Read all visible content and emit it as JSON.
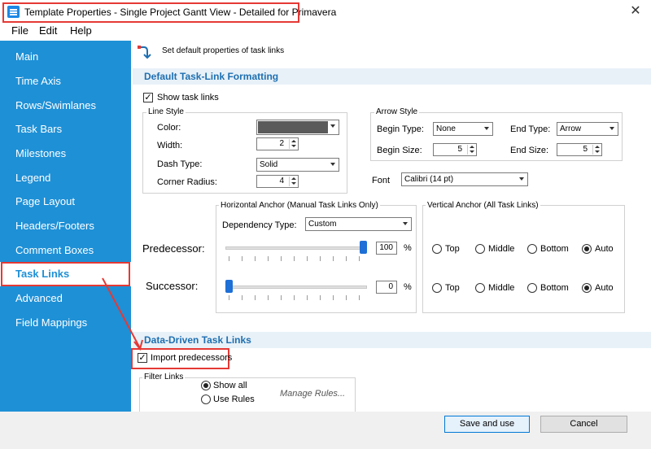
{
  "window": {
    "title": "Template Properties - Single Project Gantt View - Detailed for Primavera",
    "close_glyph": "✕"
  },
  "menu": {
    "file": "File",
    "edit": "Edit",
    "help": "Help"
  },
  "sidebar": {
    "items": [
      {
        "label": "Main"
      },
      {
        "label": "Time Axis"
      },
      {
        "label": "Rows/Swimlanes"
      },
      {
        "label": "Task Bars"
      },
      {
        "label": "Milestones"
      },
      {
        "label": "Legend"
      },
      {
        "label": "Page Layout"
      },
      {
        "label": "Headers/Footers"
      },
      {
        "label": "Comment Boxes"
      },
      {
        "label": "Task Links"
      },
      {
        "label": "Advanced"
      },
      {
        "label": "Field Mappings"
      }
    ],
    "active_index": 9
  },
  "page_header": {
    "description": "Set default properties of task links",
    "icon": "link-arrow-icon"
  },
  "formatting": {
    "section_title": "Default Task-Link Formatting",
    "show_links_label": "Show task links",
    "show_links_checked": true,
    "line_style": {
      "title": "Line Style",
      "color_label": "Color:",
      "color_value": "#5a5a5a",
      "width_label": "Width:",
      "width_value": "2",
      "dash_label": "Dash Type:",
      "dash_value": "Solid",
      "radius_label": "Corner Radius:",
      "radius_value": "4"
    },
    "arrow_style": {
      "title": "Arrow Style",
      "begin_type_label": "Begin Type:",
      "begin_type_value": "None",
      "end_type_label": "End Type:",
      "end_type_value": "Arrow",
      "begin_size_label": "Begin Size:",
      "begin_size_value": "5",
      "end_size_label": "End Size:",
      "end_size_value": "5"
    },
    "font": {
      "label": "Font",
      "value": "Calibri (14 pt)"
    }
  },
  "anchors": {
    "horizontal_title": "Horizontal Anchor (Manual Task Links Only)",
    "dependency_label": "Dependency Type:",
    "dependency_value": "Custom",
    "vertical_title": "Vertical Anchor (All Task Links)",
    "predecessor": {
      "label": "Predecessor:",
      "value": "100",
      "unit": "%",
      "slider_fraction": 1.0,
      "selected": "Auto"
    },
    "successor": {
      "label": "Successor:",
      "value": "0",
      "unit": "%",
      "slider_fraction": 0.0,
      "selected": "Auto"
    },
    "options": [
      "Top",
      "Middle",
      "Bottom",
      "Auto"
    ]
  },
  "data_driven": {
    "section_title": "Data-Driven Task Links",
    "import_label": "Import predecessors",
    "import_checked": true,
    "filter_title": "Filter Links",
    "show_all_label": "Show all",
    "use_rules_label": "Use Rules",
    "selected_filter": "Show all",
    "manage_rules_label": "Manage Rules..."
  },
  "buttons": {
    "save": "Save and use",
    "cancel": "Cancel"
  },
  "colors": {
    "sidebar": "#1e90d6",
    "highlight": "#e53935",
    "accent": "#1e6fb0"
  }
}
